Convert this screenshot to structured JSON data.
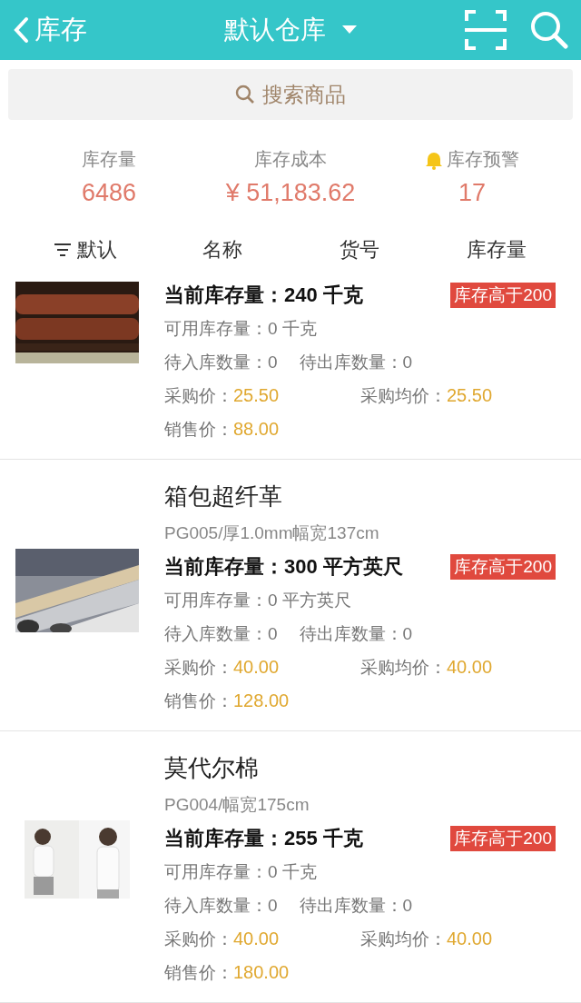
{
  "nav": {
    "back": "库存",
    "title": "默认仓库"
  },
  "search": {
    "placeholder": "搜索商品"
  },
  "stats": [
    {
      "kind": "plain",
      "label": "库存量",
      "value": "6486"
    },
    {
      "kind": "plain",
      "label": "库存成本",
      "value": "¥ 51,183.62"
    },
    {
      "kind": "alert",
      "label": "库存预警",
      "value": "17"
    }
  ],
  "sort_bar": [
    {
      "kind": "sort",
      "label": "默认"
    },
    {
      "kind": "plain",
      "label": "名称"
    },
    {
      "kind": "plain",
      "label": "货号"
    },
    {
      "kind": "plain",
      "label": "库存量"
    }
  ],
  "products": [
    {
      "stock": "当前库存量：240 千克",
      "tag": "库存高于200",
      "available": "可用库存量：0 千克",
      "incoming": "待入库数量：0",
      "outgoing": "待出库数量：0",
      "purchase_label": "采购价：",
      "purchase": "25.50",
      "avg_label": "采购均价：",
      "avg": "25.50",
      "sale_label": "销售价：",
      "sale": "88.00"
    },
    {
      "name": "箱包超纤革",
      "code": "PG005/厚1.0mm幅宽137cm",
      "stock": "当前库存量：300 平方英尺",
      "tag": "库存高于200",
      "available": "可用库存量：0 平方英尺",
      "incoming": "待入库数量：0",
      "outgoing": "待出库数量：0",
      "purchase_label": "采购价：",
      "purchase": "40.00",
      "avg_label": "采购均价：",
      "avg": "40.00",
      "sale_label": "销售价：",
      "sale": "128.00"
    },
    {
      "name": "莫代尔棉",
      "code": "PG004/幅宽175cm",
      "stock": "当前库存量：255 千克",
      "tag": "库存高于200",
      "available": "可用库存量：0 千克",
      "incoming": "待入库数量：0",
      "outgoing": "待出库数量：0",
      "purchase_label": "采购价：",
      "purchase": "40.00",
      "avg_label": "采购均价：",
      "avg": "40.00",
      "sale_label": "销售价：",
      "sale": "180.00"
    }
  ]
}
